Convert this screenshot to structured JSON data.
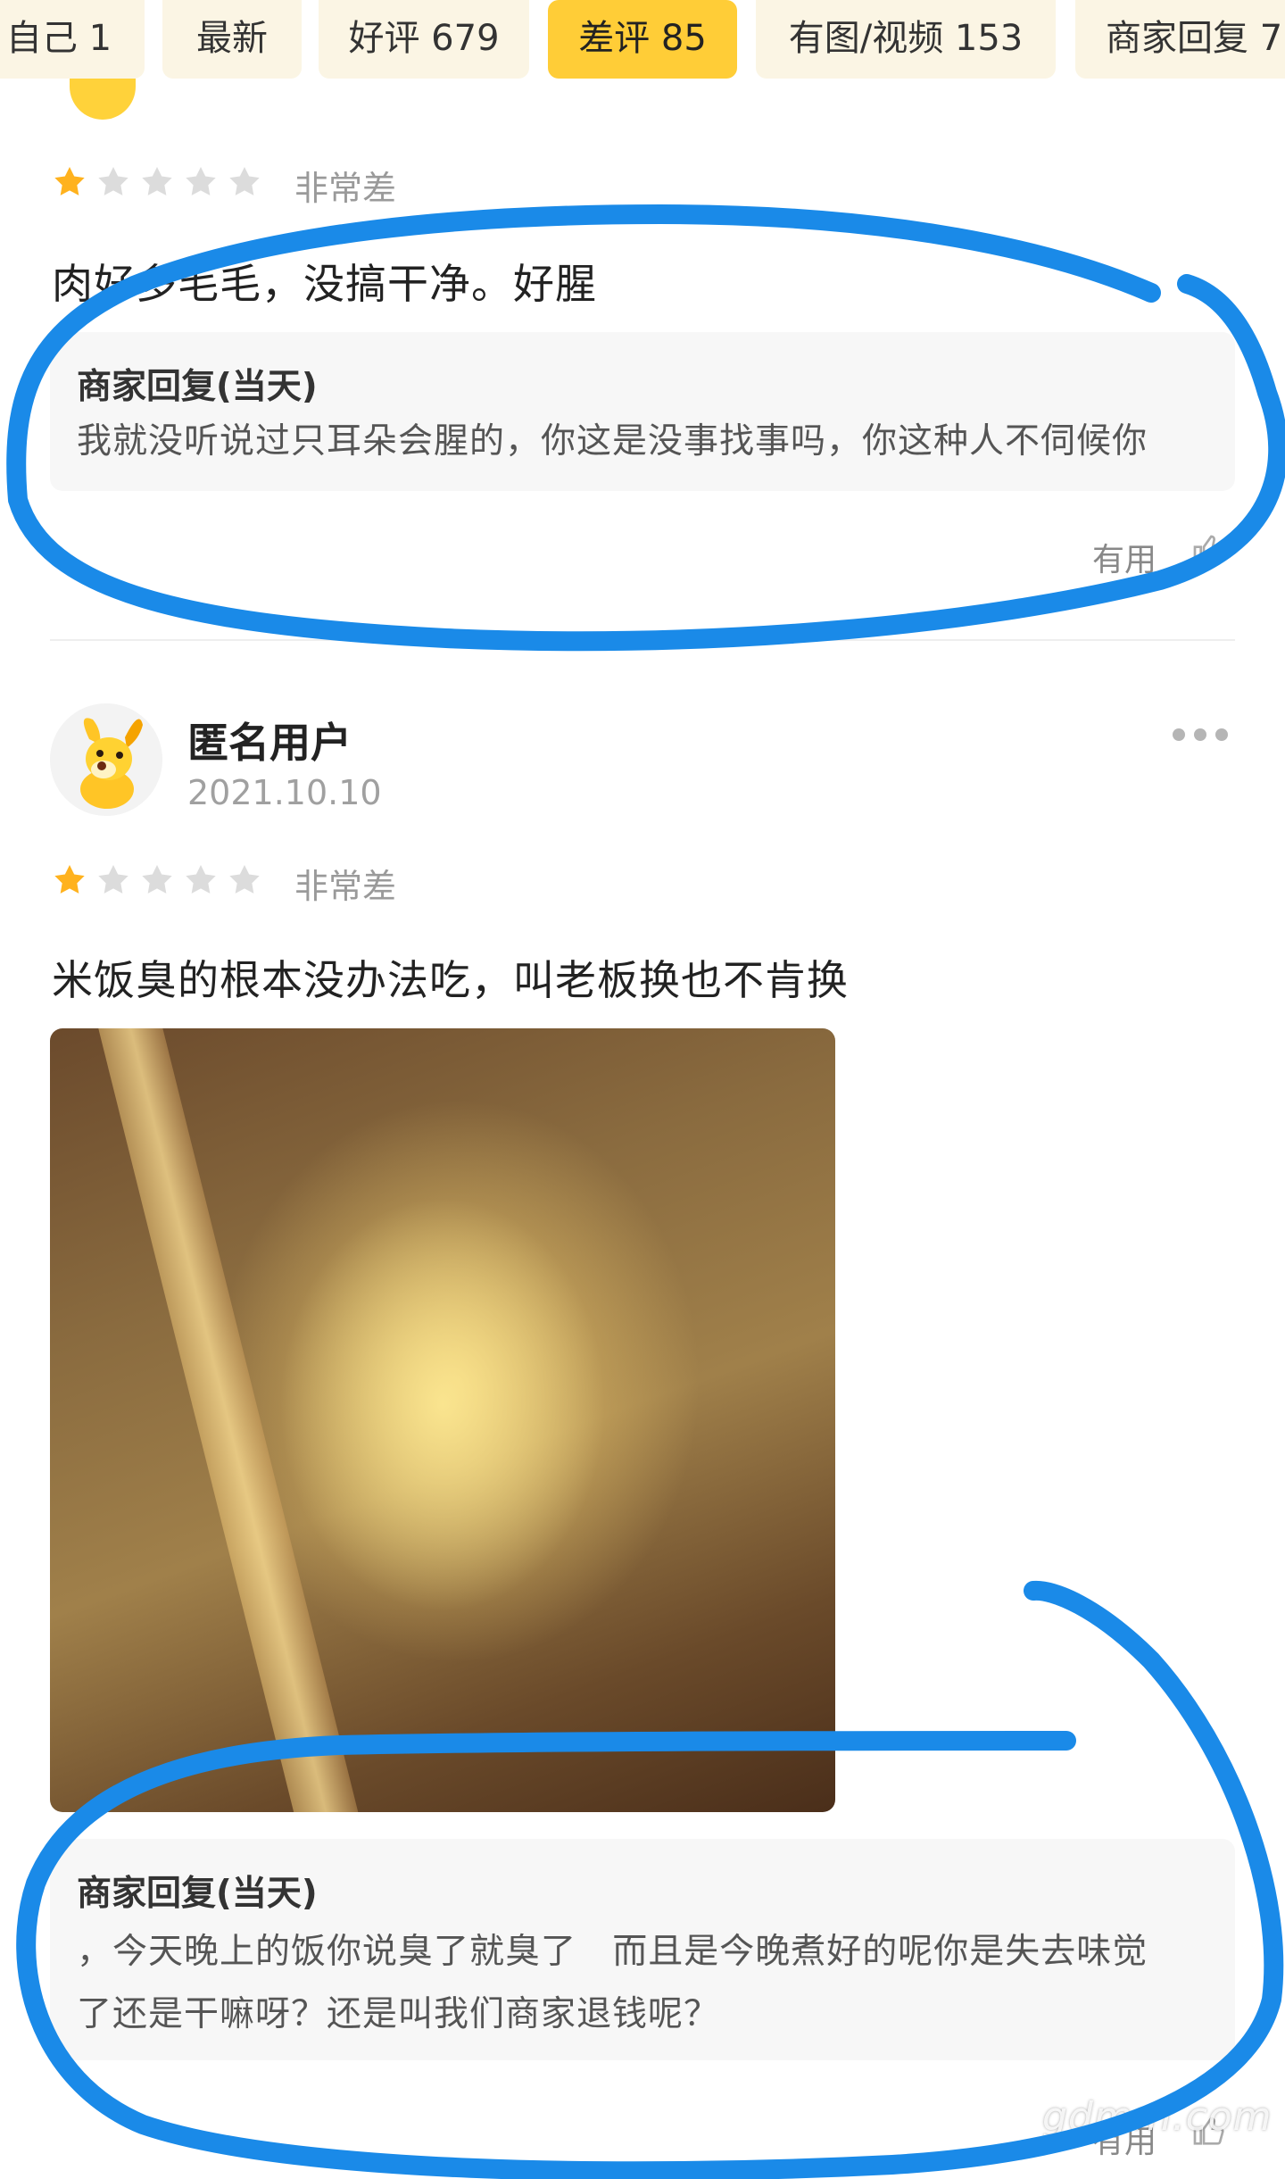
{
  "tabs": [
    {
      "label": "自己 1"
    },
    {
      "label": "最新"
    },
    {
      "label": "好评 679"
    },
    {
      "label": "差评 85",
      "active": true
    },
    {
      "label": "有图/视频 153"
    },
    {
      "label": "商家回复 7"
    }
  ],
  "review1": {
    "rating_stars": 1,
    "rating_text": "非常差",
    "text": "肉好多毛毛，没搞干净。好腥",
    "reply_title": "商家回复(当天)",
    "reply_text": "我就没听说过只耳朵会腥的，你这是没事找事吗，你这种人不伺候你",
    "useful_label": "有用"
  },
  "review2": {
    "username": "匿名用户",
    "date": "2021.10.10",
    "rating_stars": 1,
    "rating_text": "非常差",
    "text": "米饭臭的根本没办法吃，叫老板换也不肯换",
    "reply_title": "商家回复(当天)",
    "reply_text_line1": "，今天晚上的饭你说臭了就臭了   而且是今晚煮好的呢你是失去味觉",
    "reply_text_line2": "了还是干嘛呀？还是叫我们商家退钱呢？",
    "useful_label": "有用"
  },
  "watermark": "gdmm.com",
  "colors": {
    "active_tab": "#ffcd37",
    "tab_bg": "#fbf5e4",
    "star_filled": "#ffb21e",
    "star_empty": "#dcdcdc",
    "annotation": "#1a8ae8"
  }
}
